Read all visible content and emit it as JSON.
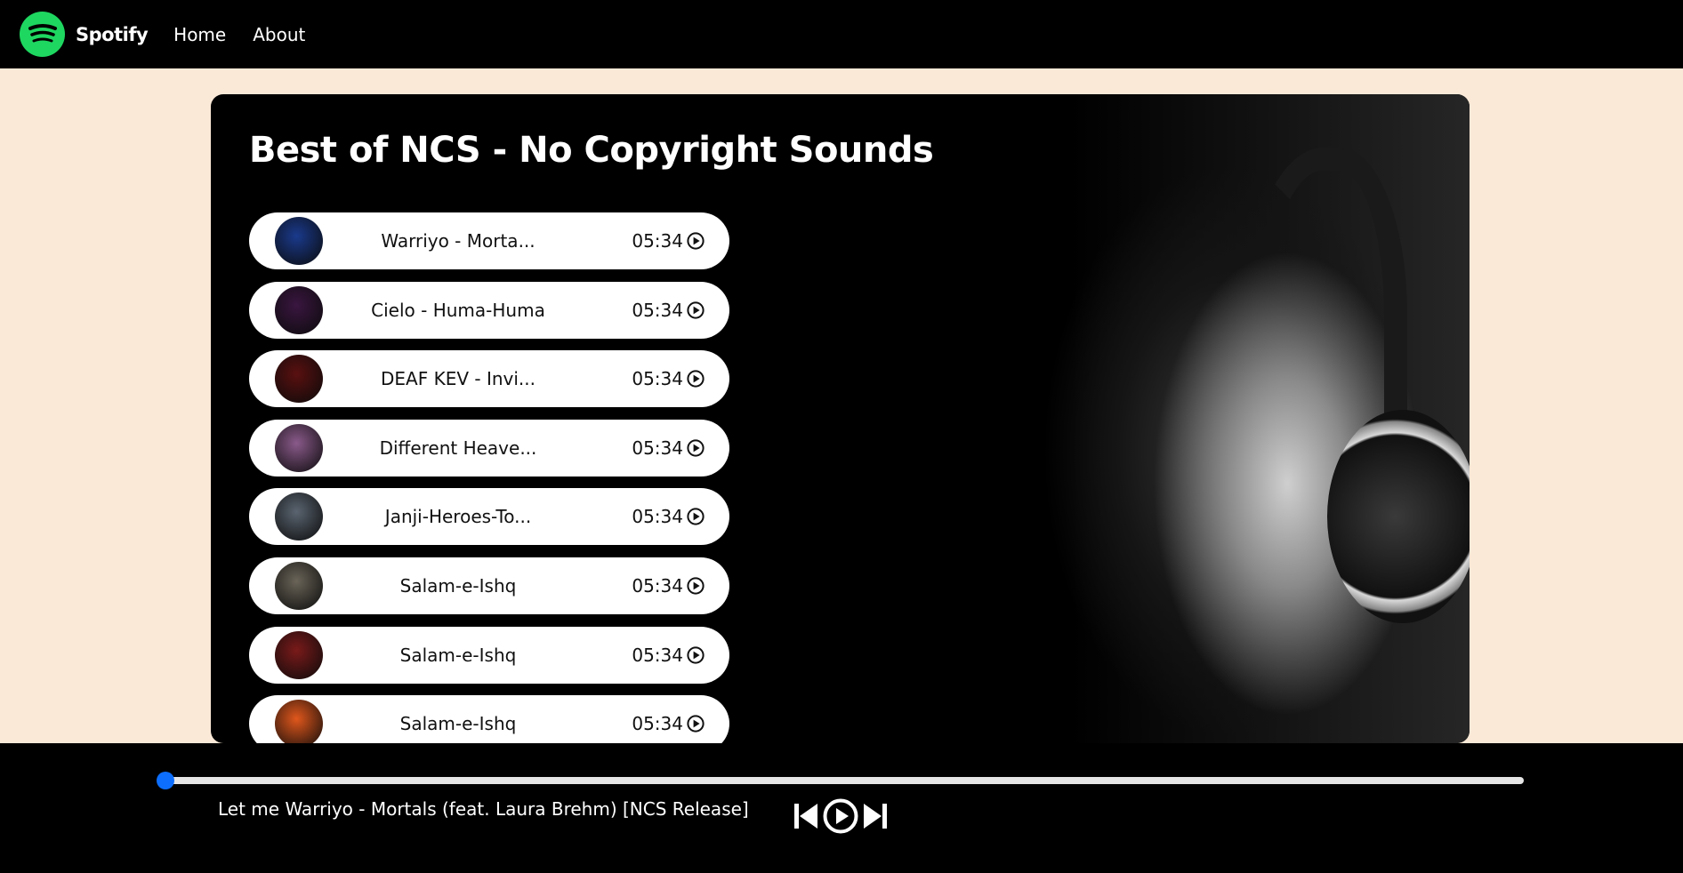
{
  "nav": {
    "brand": "Spotify",
    "links": [
      "Home",
      "About"
    ]
  },
  "playlist": {
    "title": "Best of NCS - No Copyright Sounds",
    "songs": [
      {
        "name": "Warriyo - Morta...",
        "duration": "05:34",
        "cover_color": "#1a3a8c"
      },
      {
        "name": "Cielo - Huma-Huma",
        "duration": "05:34",
        "cover_color": "#3a1640"
      },
      {
        "name": "DEAF KEV - Invi...",
        "duration": "05:34",
        "cover_color": "#5a1010"
      },
      {
        "name": "Different Heave...",
        "duration": "05:34",
        "cover_color": "#8a5a8a"
      },
      {
        "name": "Janji-Heroes-To...",
        "duration": "05:34",
        "cover_color": "#5a6470"
      },
      {
        "name": "Salam-e-Ishq",
        "duration": "05:34",
        "cover_color": "#6a6458"
      },
      {
        "name": "Salam-e-Ishq",
        "duration": "05:34",
        "cover_color": "#7a1a1a"
      },
      {
        "name": "Salam-e-Ishq",
        "duration": "05:34",
        "cover_color": "#e0571c"
      }
    ]
  },
  "player": {
    "now_playing": "Let me Warriyo - Mortals (feat. Laura Brehm) [NCS Release]",
    "progress": 0,
    "accent": "#0d6efd"
  }
}
